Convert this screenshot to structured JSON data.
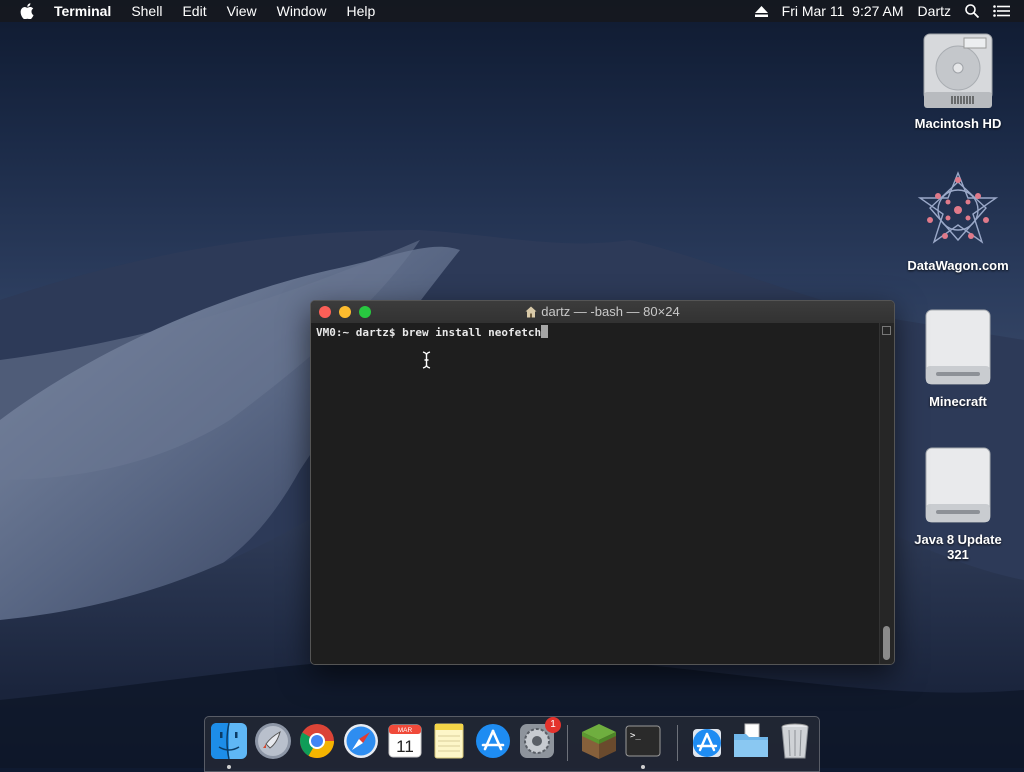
{
  "menubar": {
    "app_name": "Terminal",
    "items": [
      "Shell",
      "Edit",
      "View",
      "Window",
      "Help"
    ],
    "clock": "Fri Mar 11  9:27 AM",
    "user": "Dartz"
  },
  "desktop_icons": [
    {
      "label": "Macintosh HD"
    },
    {
      "label": "DataWagon.com"
    },
    {
      "label": "Minecraft"
    },
    {
      "label": "Java 8 Update 321"
    }
  ],
  "terminal": {
    "title": "dartz — -bash — 80×24",
    "prompt": "VM0:~ dartz$ ",
    "command": "brew install neofetch"
  },
  "dock": {
    "items": [
      "Finder",
      "Launchpad",
      "Google Chrome",
      "Safari",
      "Calendar",
      "Notes",
      "App Store",
      "System Preferences",
      "Minecraft",
      "Terminal",
      "Downloads",
      "Documents",
      "Trash"
    ],
    "calendar_month": "MAR",
    "calendar_day": "11",
    "system_prefs_badge": "1",
    "terminal_glyph": ">_"
  },
  "colors": {
    "close": "#fc5f57",
    "minimize": "#fdbc2e",
    "maximize": "#28c840",
    "badge": "#e4322c"
  }
}
